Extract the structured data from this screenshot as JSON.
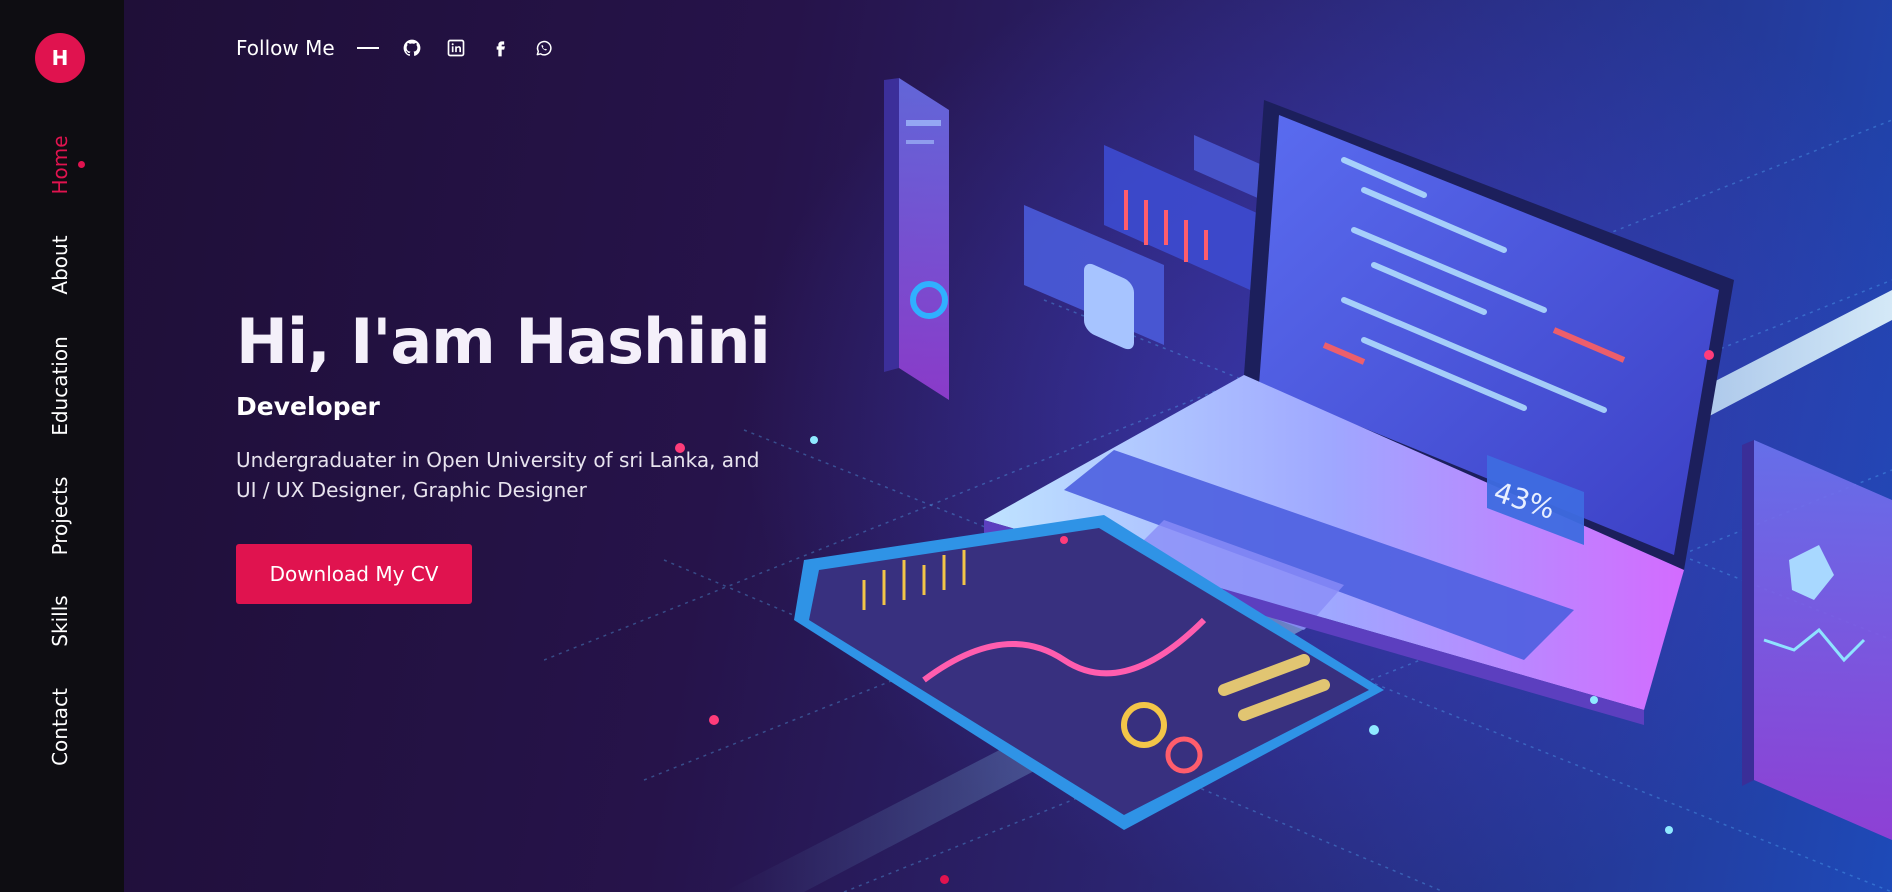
{
  "brand": {
    "initial": "H"
  },
  "sidebar": {
    "items": [
      {
        "label": "Home",
        "active": true
      },
      {
        "label": "About"
      },
      {
        "label": "Education"
      },
      {
        "label": "Projects"
      },
      {
        "label": "Skills"
      },
      {
        "label": "Contact"
      }
    ]
  },
  "follow": {
    "label": "Follow Me",
    "icons": [
      "github-icon",
      "linkedin-icon",
      "facebook-icon",
      "whatsapp-icon"
    ]
  },
  "hero": {
    "greeting": "Hi, I'am Hashini",
    "role": "Developer",
    "description": "Undergraduater in Open University of sri Lanka, and UI / UX Designer, Graphic Designer",
    "cta_label": "Download My CV",
    "illustration_text": "43%"
  },
  "colors": {
    "accent": "#e0134f",
    "sidebar_bg": "#0e0d12",
    "hero_bg": "#26134a"
  }
}
